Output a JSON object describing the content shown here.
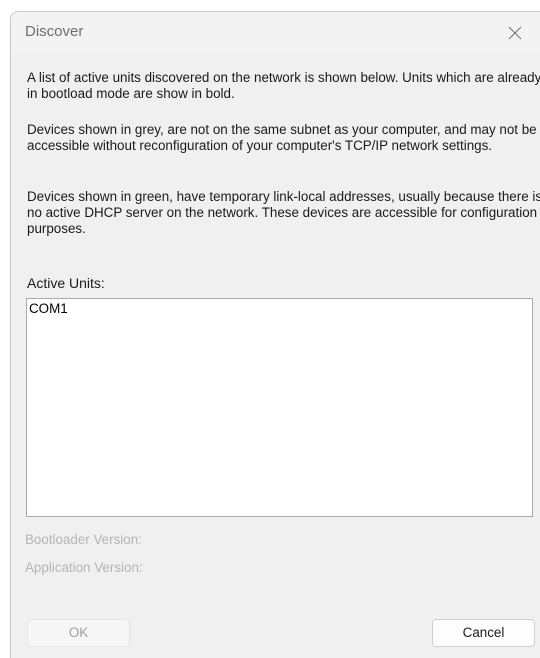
{
  "window": {
    "title": "Discover",
    "close_icon": "close-icon"
  },
  "description": {
    "paragraph1": "A list of active units discovered on the network is shown below. Units which are already in bootload mode are show in bold.",
    "paragraph2": "Devices shown in grey, are not on the same subnet as your computer, and may not be accessible without reconfiguration of your computer's TCP/IP network settings.",
    "paragraph3": "Devices shown in green, have temporary link-local addresses, usually because there is no active DHCP server on the network. These devices are accessible for configuration purposes."
  },
  "active_units": {
    "label": "Active Units:",
    "items": [
      "COM1"
    ]
  },
  "info": {
    "bootloader_version": "Bootloader Version:",
    "application_version": "Application Version:"
  },
  "buttons": {
    "ok": "OK",
    "cancel": "Cancel"
  },
  "colors": {
    "disabled_text": "#b4b4b4",
    "dialog_background": "#f0f0f0"
  }
}
